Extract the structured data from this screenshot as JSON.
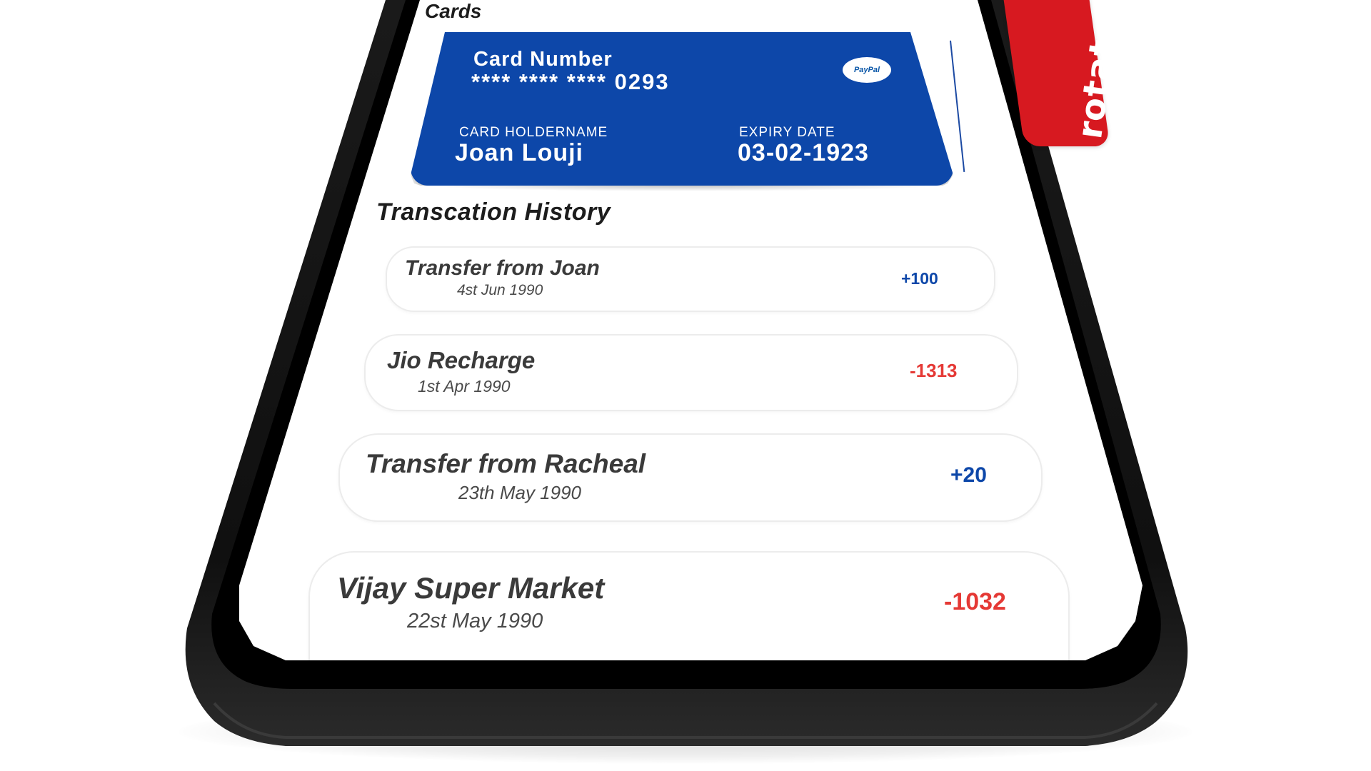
{
  "brand_tag": "rotato.xyz/f",
  "colors": {
    "card_blue": "#0d47a9",
    "credit": "#0d47a9",
    "debit": "#e53935",
    "tag_red": "#d71920"
  },
  "cards_section": {
    "title": "Cards",
    "card": {
      "number_label": "Card Number",
      "number": "**** **** **** 0293",
      "brand": "PayPal",
      "holder_label": "CARD HOLDERNAME",
      "holder_name": "Joan Louji",
      "expiry_label": "EXPIRY DATE",
      "expiry_value": "03-02-1923"
    }
  },
  "history": {
    "title": "Transcation History",
    "items": [
      {
        "title": "Transfer from Joan",
        "date": "4st Jun  1990",
        "amount": "+100",
        "type": "credit"
      },
      {
        "title": "Jio Recharge",
        "date": "1st Apr 1990",
        "amount": "-1313",
        "type": "debit"
      },
      {
        "title": "Transfer from Racheal",
        "date": "23th May 1990",
        "amount": "+20",
        "type": "credit"
      },
      {
        "title": "Vijay Super Market",
        "date": "22st May 1990",
        "amount": "-1032",
        "type": "debit"
      }
    ]
  }
}
